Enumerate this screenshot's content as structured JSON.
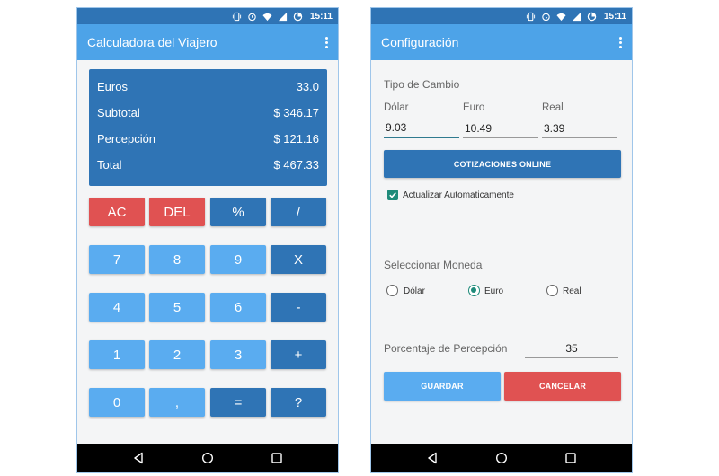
{
  "status": {
    "time": "15:11"
  },
  "calculator": {
    "title": "Calculadora del Viajero",
    "display": [
      {
        "label": "Euros",
        "value": "33.0"
      },
      {
        "label": "Subtotal",
        "value": "$ 346.17"
      },
      {
        "label": "Percepción",
        "value": "$ 121.16"
      },
      {
        "label": "Total",
        "value": "$ 467.33"
      }
    ],
    "keys": {
      "ac": "AC",
      "del": "DEL",
      "percent": "%",
      "divide": "/",
      "k7": "7",
      "k8": "8",
      "k9": "9",
      "multiply": "X",
      "k4": "4",
      "k5": "5",
      "k6": "6",
      "minus": "-",
      "k1": "1",
      "k2": "2",
      "k3": "3",
      "plus": "+",
      "k0": "0",
      "comma": ",",
      "equals": "=",
      "help": "?"
    }
  },
  "settings": {
    "title": "Configuración",
    "exchange_section": "Tipo de Cambio",
    "currencies": [
      {
        "label": "Dólar",
        "value": "9.03"
      },
      {
        "label": "Euro",
        "value": "10.49"
      },
      {
        "label": "Real",
        "value": "3.39"
      }
    ],
    "online_button": "COTIZACIONES ONLINE",
    "auto_update_label": "Actualizar Automaticamente",
    "auto_update_checked": true,
    "currency_section": "Seleccionar Moneda",
    "radio_options": [
      "Dólar",
      "Euro",
      "Real"
    ],
    "selected_currency": "Euro",
    "percent_label": "Porcentaje de Percepción",
    "percent_value": "35",
    "save_button": "GUARDAR",
    "cancel_button": "CANCELAR"
  },
  "colors": {
    "appbar": "#4da3e8",
    "statusbar": "#2f74b5",
    "display_bg": "#2f74b5",
    "key_red": "#e05252",
    "key_dark": "#2f74b5",
    "key_light": "#5aacf0",
    "accent": "#1f8b7a"
  }
}
